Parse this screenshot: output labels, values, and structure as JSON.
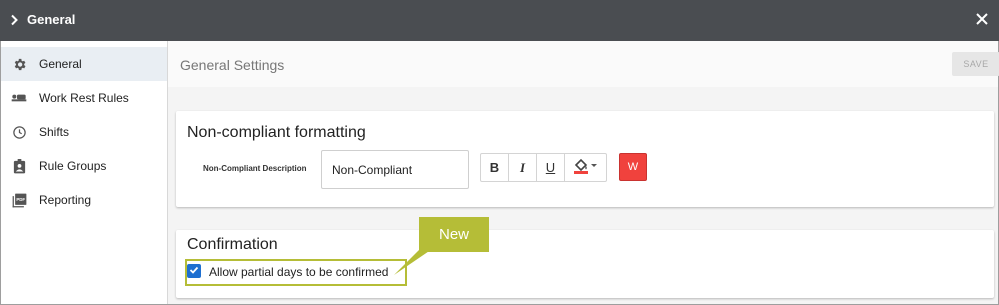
{
  "header": {
    "title": "General"
  },
  "sidebar": {
    "items": [
      {
        "label": "General",
        "icon": "gear-icon",
        "active": true
      },
      {
        "label": "Work Rest Rules",
        "icon": "bed-icon",
        "active": false
      },
      {
        "label": "Shifts",
        "icon": "clock-icon",
        "active": false
      },
      {
        "label": "Rule Groups",
        "icon": "badge-icon",
        "active": false
      },
      {
        "label": "Reporting",
        "icon": "pdf-icon",
        "active": false
      }
    ]
  },
  "main": {
    "title": "General Settings",
    "save_label": "SAVE",
    "noncompliant": {
      "title": "Non-compliant formatting",
      "field_label": "Non-Compliant Description",
      "field_value": "Non-Compliant",
      "format_buttons": [
        "B",
        "I",
        "U"
      ],
      "preview_text": "W",
      "preview_color": "#f0423d"
    },
    "confirmation": {
      "title": "Confirmation",
      "checkbox_label": "Allow partial days to be confirmed",
      "checked": true
    }
  },
  "callout": {
    "text": "New",
    "color": "#b5bd37"
  }
}
